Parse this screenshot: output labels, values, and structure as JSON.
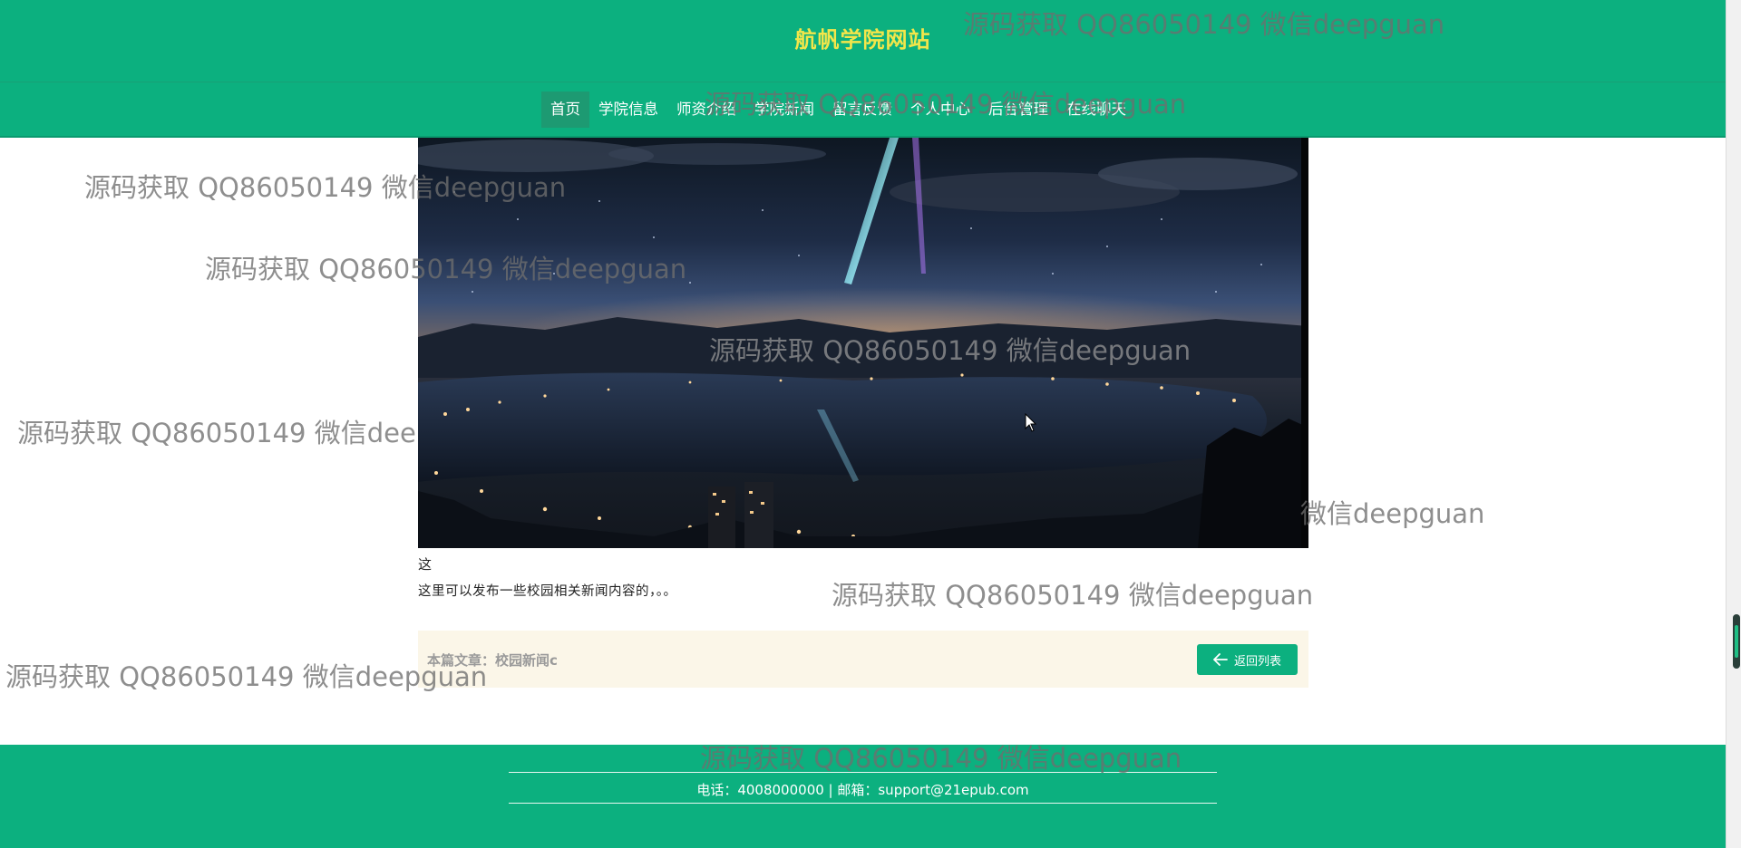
{
  "header": {
    "site_title": "航帆学院网站"
  },
  "nav": {
    "items": [
      {
        "label": "首页",
        "active": true
      },
      {
        "label": "学院信息",
        "active": false
      },
      {
        "label": "师资介绍",
        "active": false
      },
      {
        "label": "学院新闻",
        "active": false
      },
      {
        "label": "留言反馈",
        "active": false
      },
      {
        "label": "个人中心",
        "active": false
      },
      {
        "label": "后台管理",
        "active": false
      },
      {
        "label": "在线聊天",
        "active": false
      }
    ]
  },
  "article": {
    "title_char": "这",
    "body": "这里可以发布一些校园相关新闻内容的，。。"
  },
  "info_bar": {
    "label": "本篇文章：校园新闻c",
    "back_button_label": "返回列表"
  },
  "footer": {
    "contact": "电话：4008000000 | 邮箱：support@21epub.com"
  },
  "watermark": {
    "text": "源码获取 QQ86050149 微信deepguan",
    "partial_1": "源码获取 QQ86050149 微信dee",
    "partial_2": "微信deepguan"
  },
  "colors": {
    "brand_green": "#0cb07f",
    "title_yellow": "#f2e64a",
    "info_bar_bg": "#fbf6e8"
  }
}
